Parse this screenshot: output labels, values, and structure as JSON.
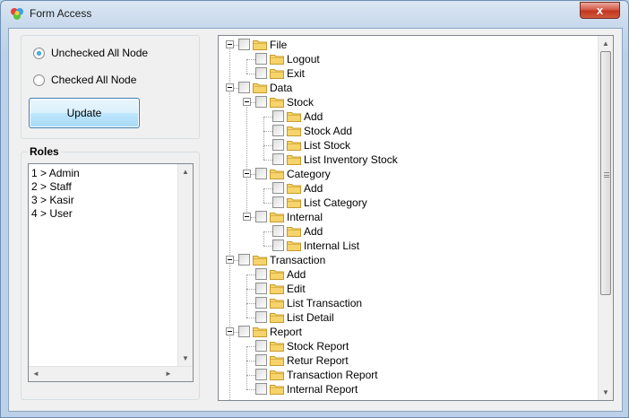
{
  "window": {
    "title": "Form Access",
    "close_glyph": "x"
  },
  "options": {
    "radio_unchecked_label": "Unchecked All Node",
    "radio_checked_label": "Checked All Node",
    "selected": "unchecked",
    "update_label": "Update"
  },
  "roles": {
    "title": "Roles",
    "items": [
      "1 > Admin",
      "2 > Staff",
      "3 > Kasir",
      "4 > User"
    ]
  },
  "tree": {
    "nodes": [
      {
        "label": "File",
        "level": 0,
        "expanded": true
      },
      {
        "label": "Logout",
        "level": 1
      },
      {
        "label": "Exit",
        "level": 1
      },
      {
        "label": "Data",
        "level": 0,
        "expanded": true
      },
      {
        "label": "Stock",
        "level": 1,
        "expanded": true
      },
      {
        "label": "Add",
        "level": 2
      },
      {
        "label": "Stock Add",
        "level": 2
      },
      {
        "label": "List Stock",
        "level": 2
      },
      {
        "label": "List Inventory Stock",
        "level": 2
      },
      {
        "label": "Category",
        "level": 1,
        "expanded": true
      },
      {
        "label": "Add",
        "level": 2
      },
      {
        "label": "List Category",
        "level": 2
      },
      {
        "label": "Internal",
        "level": 1,
        "expanded": true
      },
      {
        "label": "Add",
        "level": 2
      },
      {
        "label": "Internal List",
        "level": 2
      },
      {
        "label": "Transaction",
        "level": 0,
        "expanded": true
      },
      {
        "label": "Add",
        "level": 1
      },
      {
        "label": "Edit",
        "level": 1
      },
      {
        "label": "List Transaction",
        "level": 1
      },
      {
        "label": "List Detail",
        "level": 1
      },
      {
        "label": "Report",
        "level": 0,
        "expanded": true
      },
      {
        "label": "Stock Report",
        "level": 1
      },
      {
        "label": "Retur Report",
        "level": 1
      },
      {
        "label": "Transaction Report",
        "level": 1
      },
      {
        "label": "Internal Report",
        "level": 1
      }
    ]
  },
  "icons": {
    "app": "app-icon",
    "folder": "folder-icon",
    "scroll_up": "▲",
    "scroll_down": "▼",
    "scroll_left": "◄",
    "scroll_right": "►"
  },
  "colors": {
    "folder_fill": "#f6d46b",
    "folder_edge": "#c89a2b",
    "accent_radio": "#0d6fb5"
  }
}
